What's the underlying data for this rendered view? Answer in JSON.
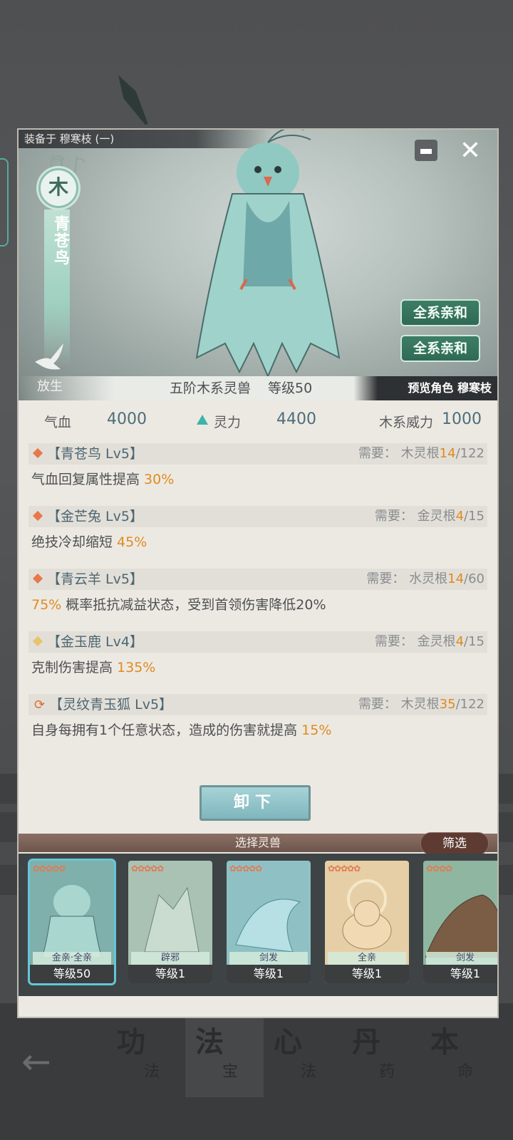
{
  "panel": {
    "equipped_label": "装备于 穆寒枝 (一)",
    "element": "木",
    "beast_name": "青苍鸟",
    "release_label": "放生",
    "affinity_buttons": [
      "全系亲和",
      "全系亲和"
    ],
    "info_tier": "五阶木系灵兽",
    "info_level": "等级50",
    "preview_label": "预览角色 穆寒枝",
    "close_icon": "close-icon"
  },
  "stats": {
    "hp_label": "气血",
    "hp_value": "4000",
    "spirit_label": "灵力",
    "spirit_value": "4400",
    "power_label": "木系威力",
    "power_value": "1000"
  },
  "skills": [
    {
      "title": "【青苍鸟 Lv5】",
      "need_prefix": "需要：",
      "need_root": "木灵根",
      "cur": "14",
      "total": "/122",
      "desc_a": "气血回复属性提高 ",
      "desc_hl": "30%",
      "desc_b": "",
      "marker": "diamond-orange"
    },
    {
      "title": "【金芒兔 Lv5】",
      "need_prefix": "需要：",
      "need_root": "金灵根",
      "cur": "4",
      "total": "/15",
      "desc_a": "绝技冷却缩短 ",
      "desc_hl": "45%",
      "desc_b": "",
      "marker": "diamond-orange"
    },
    {
      "title": "【青云羊 Lv5】",
      "need_prefix": "需要：",
      "need_root": "水灵根",
      "cur": "14",
      "total": "/60",
      "desc_a": "",
      "desc_hl": "75%",
      "desc_b": " 概率抵抗减益状态，受到首领伤害降低20%",
      "marker": "diamond-orange"
    },
    {
      "title": "【金玉鹿 Lv4】",
      "need_prefix": "需要：",
      "need_root": "金灵根",
      "cur": "4",
      "total": "/15",
      "desc_a": "克制伤害提高 ",
      "desc_hl": "135%",
      "desc_b": "",
      "marker": "diamond-gold"
    },
    {
      "title": "【灵纹青玉狐 Lv5】",
      "need_prefix": "需要：",
      "need_root": "木灵根",
      "cur": "35",
      "total": "/122",
      "desc_a": "自身每拥有1个任意状态，造成的伤害就提高 ",
      "desc_hl": "15%",
      "desc_b": "",
      "marker": "recycle"
    }
  ],
  "unequip_label": "卸下",
  "select_label": "选择灵兽",
  "filter_label": "筛选",
  "beast_cards": [
    {
      "stars": "✿✿✿✿✿",
      "tag": "金亲·全亲",
      "level": "等级50",
      "color": "#7fb0ab"
    },
    {
      "stars": "✿✿✿✿✿",
      "tag": "辟邪",
      "level": "等级1",
      "color": "#a9c2b4"
    },
    {
      "stars": "✿✿✿✿✿",
      "tag": "剑发",
      "level": "等级1",
      "color": "#8fc1c4"
    },
    {
      "stars": "✿✿✿✿✿",
      "tag": "全亲",
      "level": "等级1",
      "color": "#e6cfa6"
    },
    {
      "stars": "✿✿✿✿",
      "tag": "剑发",
      "level": "等级1",
      "color": "#8fb6a0"
    }
  ],
  "bottom_nav": [
    {
      "big": "功",
      "small": "法"
    },
    {
      "big": "法",
      "small": "宝"
    },
    {
      "big": "心",
      "small": "法"
    },
    {
      "big": "丹",
      "small": "药"
    },
    {
      "big": "本",
      "small": "命"
    }
  ],
  "back_icon": "back-arrow-icon"
}
